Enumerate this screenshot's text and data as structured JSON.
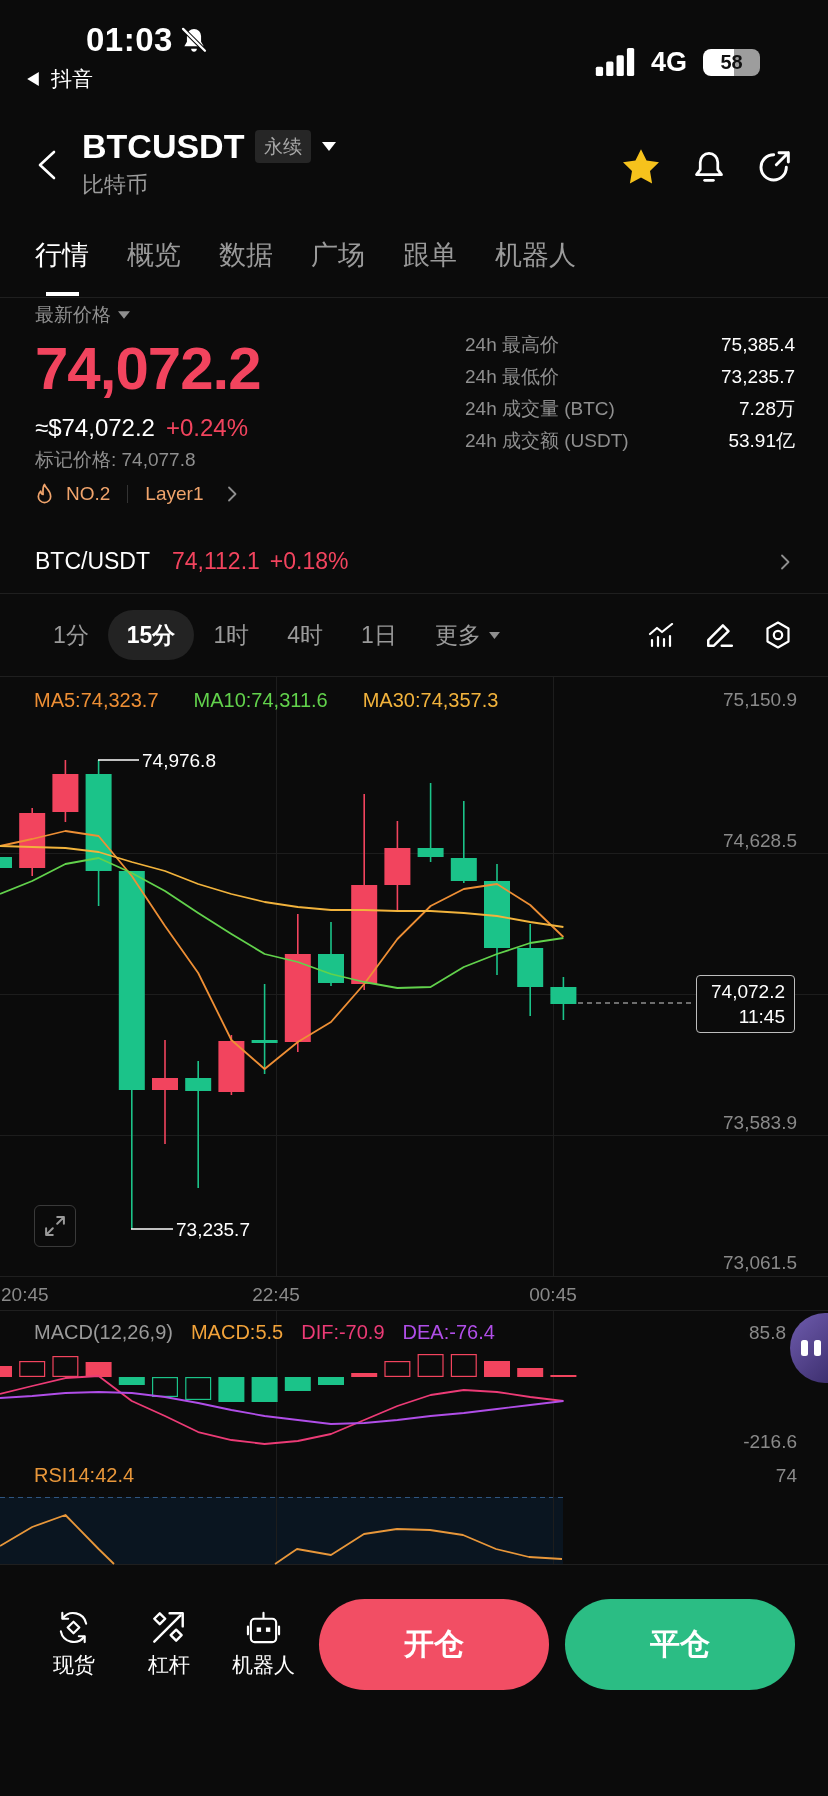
{
  "status_bar": {
    "time": "01:03",
    "back_app": "抖音",
    "network": "4G",
    "battery": "58"
  },
  "header": {
    "symbol": "BTCUSDT",
    "contract_type": "永续",
    "name": "比特币",
    "favorite": true
  },
  "tabs": [
    {
      "label": "行情",
      "selected": true
    },
    {
      "label": "概览",
      "selected": false
    },
    {
      "label": "数据",
      "selected": false
    },
    {
      "label": "广场",
      "selected": false
    },
    {
      "label": "跟单",
      "selected": false
    },
    {
      "label": "机器人",
      "selected": false
    }
  ],
  "price": {
    "label": "最新价格",
    "last": "74,072.2",
    "usd": "≈$74,072.2",
    "change": "+0.24%",
    "mark_price": "标记价格: 74,077.8",
    "rank": "NO.2",
    "sector": "Layer1"
  },
  "stats": [
    {
      "label": "24h 最高价",
      "value": "75,385.4"
    },
    {
      "label": "24h 最低价",
      "value": "73,235.7"
    },
    {
      "label": "24h 成交量 (BTC)",
      "value": "7.28万"
    },
    {
      "label": "24h 成交额 (USDT)",
      "value": "53.91亿"
    }
  ],
  "spot": {
    "pair": "BTC/USDT",
    "price": "74,112.1",
    "change": "+0.18%"
  },
  "intervals": [
    {
      "label": "1分",
      "selected": false,
      "kind": "interval"
    },
    {
      "label": "15分",
      "selected": true,
      "kind": "interval"
    },
    {
      "label": "1时",
      "selected": false,
      "kind": "interval"
    },
    {
      "label": "4时",
      "selected": false,
      "kind": "interval"
    },
    {
      "label": "1日",
      "selected": false,
      "kind": "interval"
    },
    {
      "label": "更多",
      "selected": false,
      "kind": "dropdown"
    }
  ],
  "chart": {
    "legend": [
      {
        "text": "MA5:74,323.7",
        "color": "#ee8f35"
      },
      {
        "text": "MA10:74,311.6",
        "color": "#62d24c"
      },
      {
        "text": "MA30:74,357.3",
        "color": "#f2b33c"
      }
    ],
    "price_axis": [
      "75,150.9",
      "74,628.5",
      "73,583.9",
      "73,061.5"
    ],
    "high": "74,976.8",
    "low": "73,235.7",
    "price_tag": {
      "price": "74,072.2",
      "countdown": "11:45"
    },
    "time_axis": [
      "20:45",
      "22:45",
      "00:45"
    ]
  },
  "macd": {
    "legend": [
      {
        "text": "MACD(12,26,9)",
        "color": "#9a9a9a"
      },
      {
        "text": "MACD:5.5",
        "color": "#f2a33a"
      },
      {
        "text": "DIF:-70.9",
        "color": "#ec3b76"
      },
      {
        "text": "DEA:-76.4",
        "color": "#b04ee8"
      }
    ],
    "axis": [
      "85.8",
      "-216.6"
    ]
  },
  "rsi": {
    "legend": "RSI14:42.4",
    "axis": "74"
  },
  "actions": {
    "shortcuts": [
      {
        "label": "现货",
        "kind": "spot"
      },
      {
        "label": "杠杆",
        "kind": "margin"
      },
      {
        "label": "机器人",
        "kind": "bot"
      }
    ],
    "buttons": [
      {
        "label": "开仓",
        "kind": "open"
      },
      {
        "label": "平仓",
        "kind": "close"
      }
    ]
  }
}
